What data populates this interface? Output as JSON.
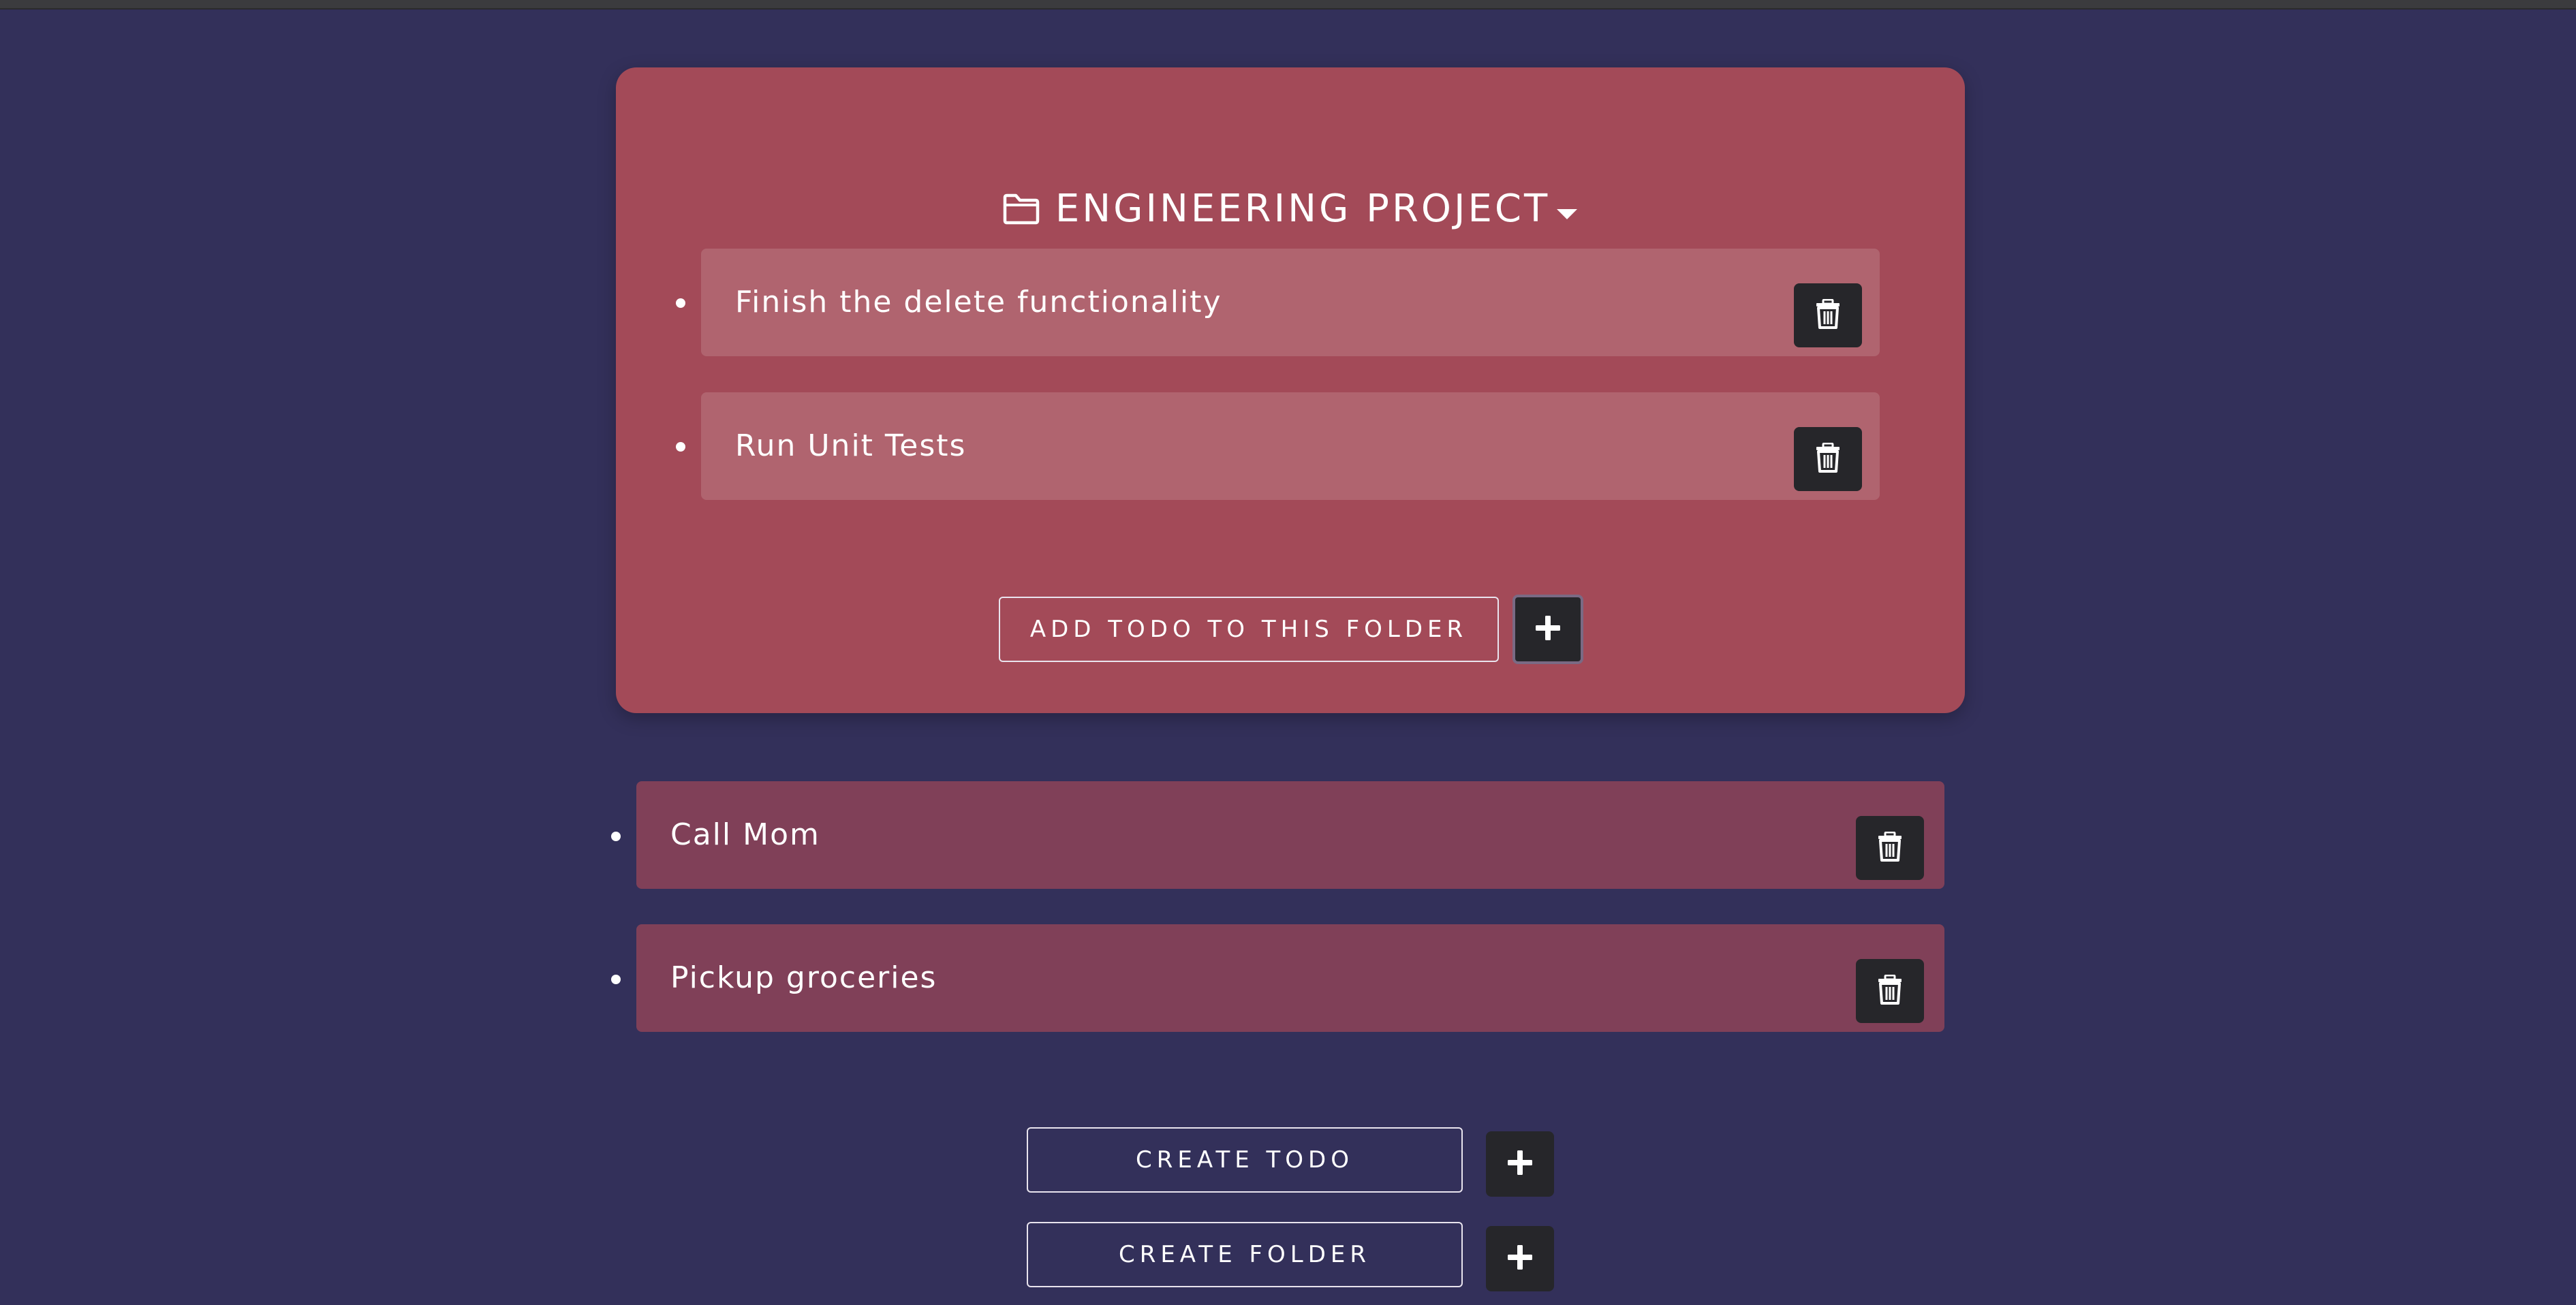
{
  "folder": {
    "title": "ENGINEERING PROJECT",
    "todos": [
      {
        "text": "Finish the delete functionality"
      },
      {
        "text": "Run Unit Tests"
      }
    ],
    "add_todo_label": "ADD TODO TO THIS FOLDER"
  },
  "todos": [
    {
      "text": "Call Mom"
    },
    {
      "text": "Pickup groceries"
    }
  ],
  "actions": {
    "create_todo_label": "CREATE TODO",
    "create_folder_label": "CREATE FOLDER"
  },
  "icons": {
    "folder": "folder-outline-icon",
    "caret": "caret-down-icon",
    "trash": "trash-icon",
    "plus": "plus-icon"
  },
  "colors": {
    "background": "#33305a",
    "folder_card": "#a34a58",
    "folder_todo": "#b0646f",
    "root_todo": "#804058",
    "dark_button": "#26262a",
    "text": "#ffffff"
  }
}
